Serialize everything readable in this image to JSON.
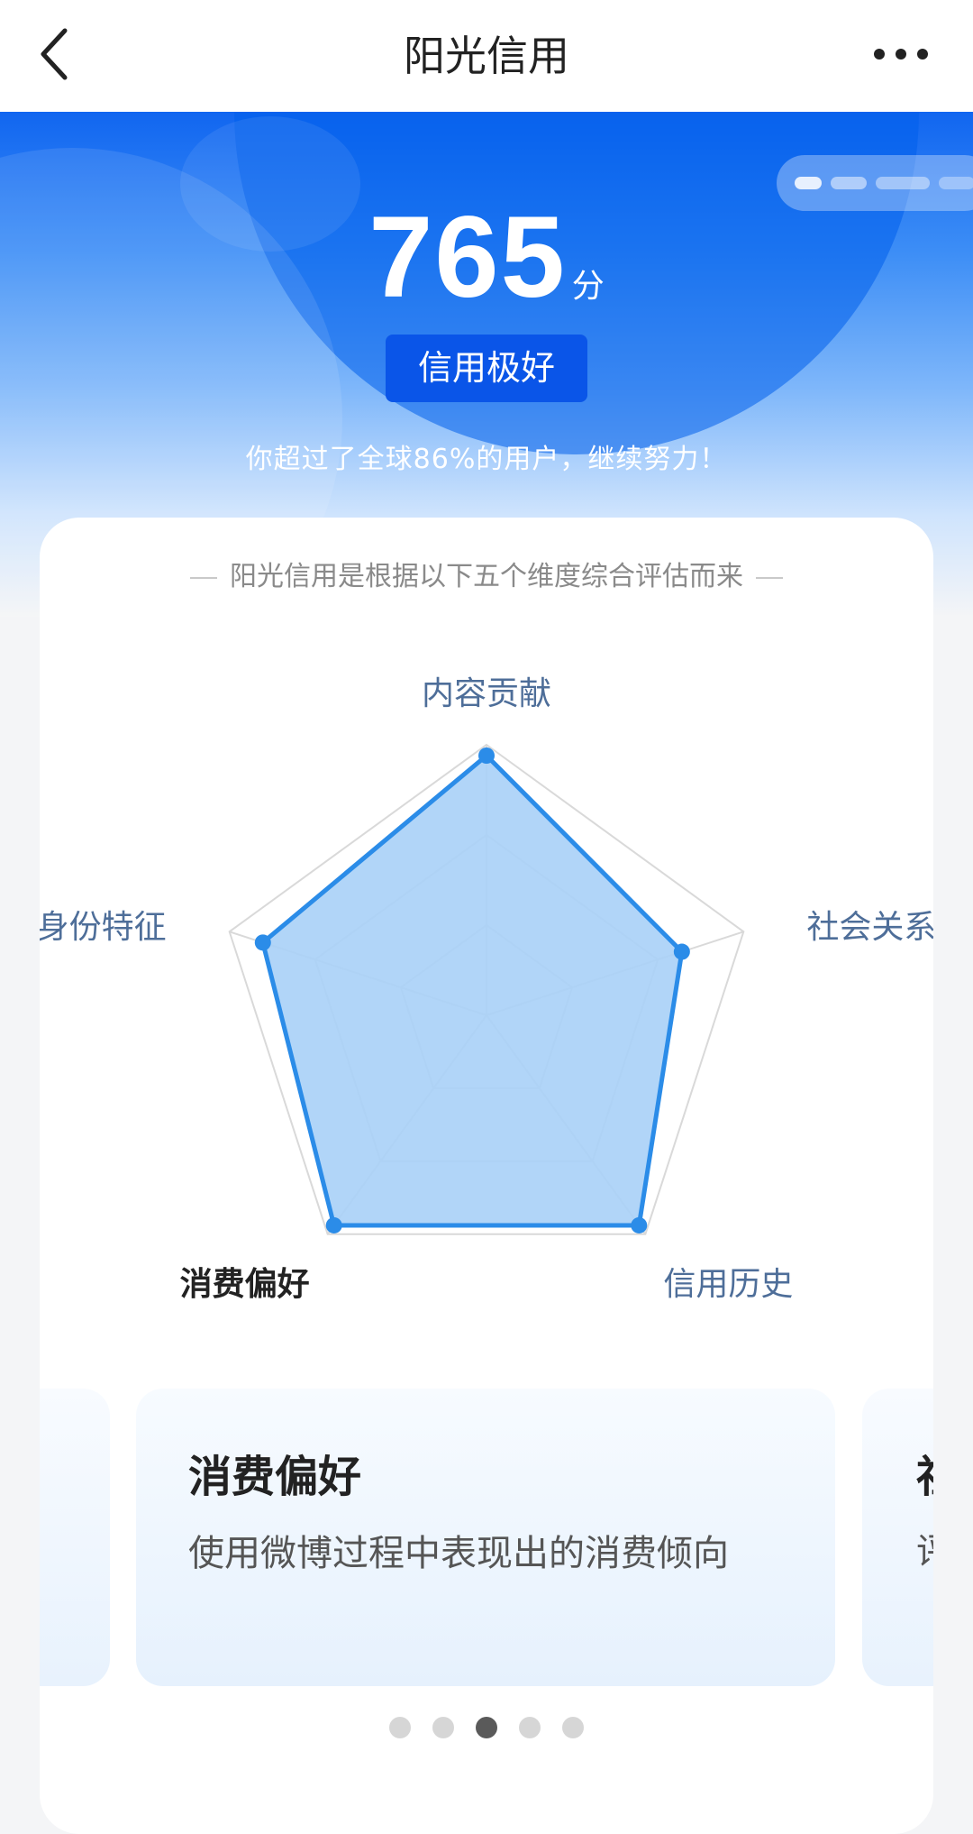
{
  "nav": {
    "title": "阳光信用"
  },
  "score": {
    "value": "765",
    "unit": "分",
    "level": "信用极好",
    "tip": "你超过了全球86%的用户，继续努力！"
  },
  "card": {
    "subtitle": "阳光信用是根据以下五个维度综合评估而来"
  },
  "chart_data": {
    "type": "radar",
    "axes": [
      "内容贡献",
      "社会关系",
      "信用历史",
      "消费偏好",
      "身份特征"
    ],
    "values": [
      0.96,
      0.76,
      0.96,
      0.96,
      0.87
    ],
    "rmax": 1,
    "rings": 3,
    "active_axis": "消费偏好",
    "series_color": "#2b8ce8",
    "fill_color": "#a8d0f7",
    "grid_color": "#d9d9d9"
  },
  "carousel": {
    "active_index": 2,
    "total": 5,
    "current": {
      "title": "消费偏好",
      "desc": "使用微博过程中表现出的消费倾向"
    },
    "next": {
      "title": "社会关系",
      "desc": "评估用户在微博上的社交关系网络注"
    }
  }
}
